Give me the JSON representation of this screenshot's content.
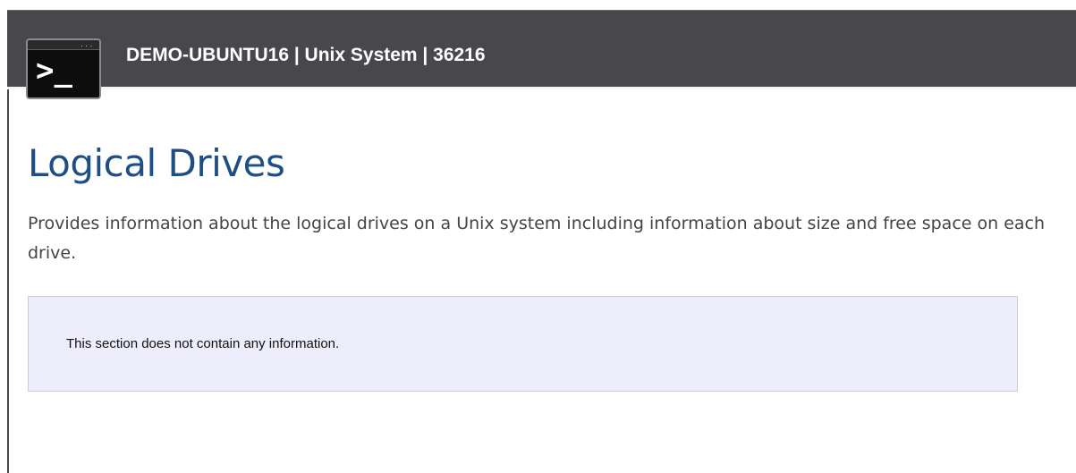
{
  "header": {
    "title": "DEMO-UBUNTU16 | Unix System | 36216",
    "icon": "terminal-icon",
    "icon_prompt": ">_",
    "icon_dots": "...",
    "background_color": "#48484c"
  },
  "main": {
    "title": "Logical Drives",
    "description": "Provides information about the logical drives on a Unix system including information about size and free space on each drive.",
    "title_color": "#1f4e84"
  },
  "info_box": {
    "message": "This section does not contain any information.",
    "background_color": "#eeedfb",
    "border_color": "#c9c6f0"
  }
}
